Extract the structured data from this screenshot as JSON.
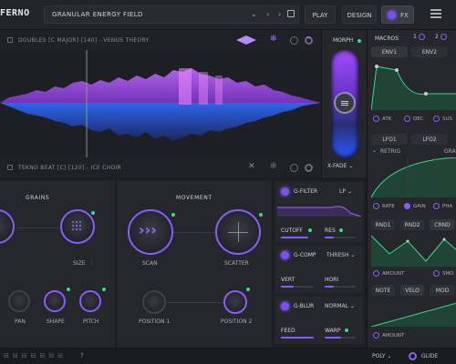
{
  "header": {
    "logo": "FERNO",
    "preset_name": "GRANULAR ENERGY FIELD",
    "play_label": "PLAY",
    "design_label": "DESIGN",
    "fx_label": "FX"
  },
  "sample_a": {
    "label": "DOUBLES [C MAJOR] [140] - VENUS THEORY"
  },
  "sample_b": {
    "label": "TEKNO BEAT [C] [120] - ICE CHOIR"
  },
  "morph": {
    "title": "MORPH",
    "mode": "X-FADE"
  },
  "grains": {
    "title": "GRAINS",
    "size_label": "SIZE",
    "pan_label": "PAN",
    "shape_label": "SHAPE",
    "pitch_label": "PITCH"
  },
  "movement": {
    "title": "MOVEMENT",
    "scan_label": "SCAN",
    "scatter_label": "SCATTER",
    "pos1_label": "POSITION 1",
    "pos2_label": "POSITION 2"
  },
  "fx": {
    "gfilter": {
      "title": "G-FILTER",
      "mode": "LP",
      "p1": "CUTOFF",
      "p2": "RES"
    },
    "gcomp": {
      "title": "G-COMP",
      "mode": "THRESH",
      "p1": "VERT",
      "p2": "HORI"
    },
    "gblur": {
      "title": "G-BLUR",
      "mode": "NORMAL",
      "p1": "FEED",
      "p2": "WARP"
    }
  },
  "macros": {
    "title": "MACROS",
    "m1": "1",
    "m2": "2"
  },
  "env": {
    "tab1": "ENV1",
    "tab2": "ENV2",
    "atk": "ATK",
    "dec": "DEC",
    "sus": "SUS"
  },
  "lfo": {
    "tab1": "LFO1",
    "tab2": "LFO2",
    "retrig": "RETRIG",
    "grid": "GRA",
    "rate": "RATE",
    "gain": "GAIN",
    "phase": "PHA"
  },
  "rnd": {
    "tab1": "RND1",
    "tab2": "RND2",
    "tab3": "CRND",
    "amount": "AMOUNT",
    "smooth": "SMO"
  },
  "note": {
    "tab1": "NOTE",
    "tab2": "VELO",
    "tab3": "MOD",
    "amount": "AMOUNT"
  },
  "footer": {
    "poly": "POLY",
    "glide": "GLIDE"
  },
  "colors": {
    "accent": "#8a5cff",
    "green": "#39d98a",
    "magenta": "#e35bff",
    "blue": "#3a6dff"
  }
}
